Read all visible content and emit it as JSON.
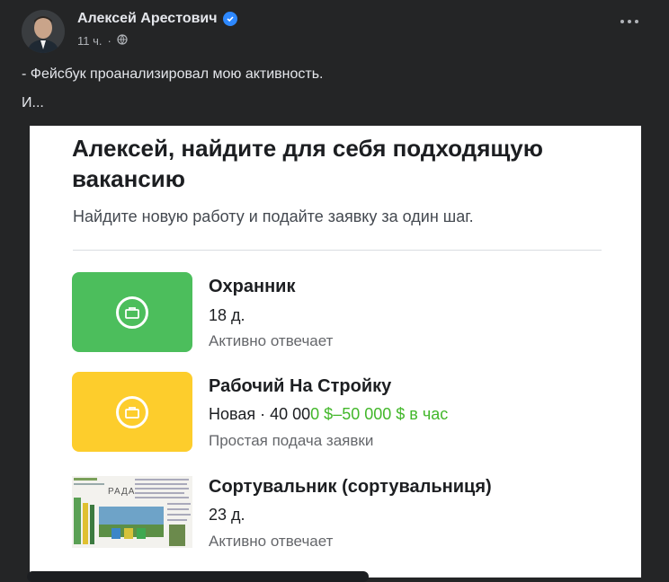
{
  "post": {
    "author": "Алексей Арестович",
    "time": "11 ч.",
    "separator": "·",
    "text_line1": "- Фейсбук проанализировал мою активность.",
    "text_line2": "И..."
  },
  "card": {
    "title": "Алексей, найдите для себя подходящую вакансию",
    "subtitle": "Найдите новую работу и подайте заявку за один шаг.",
    "jobs": [
      {
        "title": "Охранник",
        "meta": "18 д.",
        "status": "Активно отвечает",
        "icon": "briefcase-icon",
        "color": "#4cbe5c"
      },
      {
        "title": "Рабочий На Стройку",
        "meta_prefix": "Новая · 40 00",
        "meta_salary": "0 $–50 000 $ в час",
        "status": "Простая подача заявки",
        "icon": "briefcase-icon",
        "color": "#fdcd2c"
      },
      {
        "title": "Сортувальник (сортувальниця)",
        "meta": "23 д.",
        "status": "Активно отвечает",
        "thumb_label": "РАДА"
      }
    ]
  },
  "colors": {
    "background": "#242526",
    "card": "#ffffff",
    "accent_green": "#42b72a",
    "verified": "#2d88ff"
  }
}
